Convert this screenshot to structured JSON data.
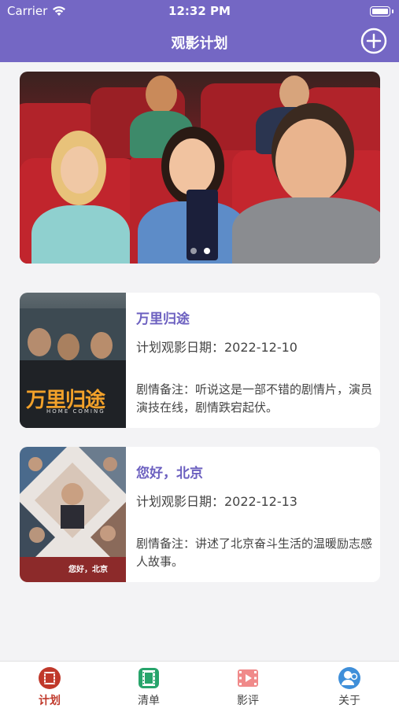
{
  "status_bar": {
    "carrier": "Carrier",
    "time": "12:32 PM"
  },
  "nav": {
    "title": "观影计划",
    "add_icon": "plus-circle-icon"
  },
  "banner": {
    "pages": 2,
    "active_page": 2
  },
  "movies": [
    {
      "title": "万里归途",
      "date": "计划观影日期：2022-12-10",
      "note": "剧情备注：听说这是一部不错的剧情片，演员演技在线，剧情跌宕起伏。",
      "poster_text": "万里归途",
      "poster_subtext": "HOME COMING"
    },
    {
      "title": "您好，北京",
      "date": "计划观影日期：2022-12-13",
      "note": "剧情备注：讲述了北京奋斗生活的温暖励志感人故事。",
      "poster_text": "您好，北京"
    }
  ],
  "tabs": [
    {
      "label": "计划",
      "icon": "film-reel-icon",
      "active": true
    },
    {
      "label": "清单",
      "icon": "film-strip-icon",
      "active": false
    },
    {
      "label": "影评",
      "icon": "movie-clapper-icon",
      "active": false
    },
    {
      "label": "关于",
      "icon": "user-icon",
      "active": false
    }
  ],
  "colors": {
    "header": "#7467c4",
    "title": "#6c60c0",
    "active_tab": "#c0392b"
  }
}
